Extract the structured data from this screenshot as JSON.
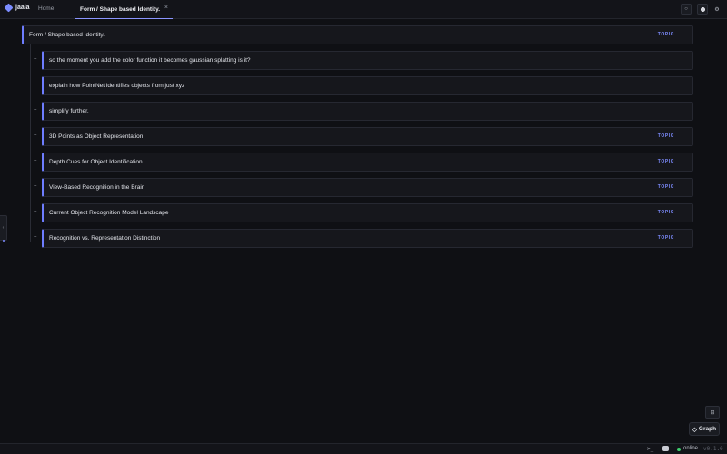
{
  "app": {
    "name": "jaala"
  },
  "tabs": {
    "home": "Home",
    "active": "Form / Shape based Identity.",
    "close_glyph": "×"
  },
  "topbar": {
    "btn1_glyph": "○",
    "btn3_glyph": "⚙"
  },
  "root": {
    "title": "Form / Shape based Identity.",
    "badge": "TOPIC"
  },
  "children": [
    {
      "title": "so the moment you add the color function it becomes gaussian splatting is it?",
      "badge": ""
    },
    {
      "title": "explain how PointNet identifies objects from just xyz",
      "badge": ""
    },
    {
      "title": "simplify further.",
      "badge": ""
    },
    {
      "title": "3D Points as Object Representation",
      "badge": "TOPIC"
    },
    {
      "title": "Depth Cues for Object Identification",
      "badge": "TOPIC"
    },
    {
      "title": "View-Based Recognition in the Brain",
      "badge": "TOPIC"
    },
    {
      "title": "Current Object Recognition Model Landscape",
      "badge": "TOPIC"
    },
    {
      "title": "Recognition vs. Representation Distinction",
      "badge": "TOPIC"
    }
  ],
  "expander_glyph": "+",
  "left_handle_glyph": "‹",
  "float_button_glyph": "⊟",
  "graph_button": {
    "glyph": "◇",
    "label": "Graph"
  },
  "statusbar": {
    "terminal": ">_",
    "status": "online",
    "version": "v0.1.0"
  },
  "colors": {
    "accent": "#6e7dff",
    "online": "#3ecf6e",
    "background": "#0f1014"
  }
}
